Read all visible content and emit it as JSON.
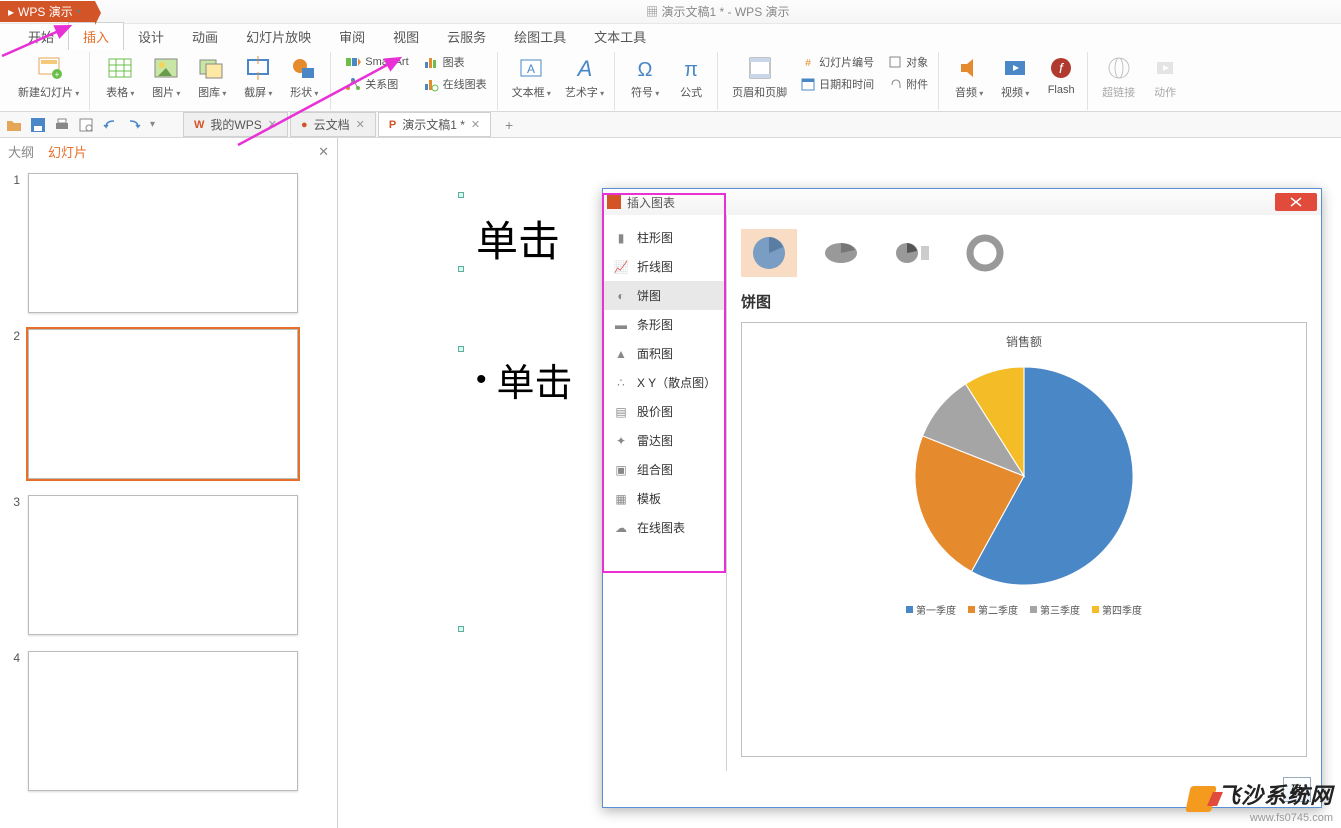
{
  "app_name": "WPS 演示",
  "window_title": "演示文稿1 * - WPS 演示",
  "menu_tabs": [
    "开始",
    "插入",
    "设计",
    "动画",
    "幻灯片放映",
    "审阅",
    "视图",
    "云服务",
    "绘图工具",
    "文本工具"
  ],
  "active_menu_tab": 1,
  "ribbon": {
    "new_slide": "新建幻灯片",
    "table": "表格",
    "picture": "图片",
    "gallery": "图库",
    "screenshot": "截屏",
    "shapes": "形状",
    "smartart": "SmartArt",
    "chart": "图表",
    "relation": "关系图",
    "online_chart": "在线图表",
    "textbox": "文本框",
    "wordart": "艺术字",
    "symbol": "符号",
    "equation": "公式",
    "header_footer": "页眉和页脚",
    "slide_number": "幻灯片编号",
    "datetime": "日期和时间",
    "object": "对象",
    "attachment": "附件",
    "audio": "音频",
    "video": "视频",
    "flash": "Flash",
    "hyperlink": "超链接",
    "action": "动作"
  },
  "doc_tabs": [
    {
      "label": "我的WPS",
      "prefix": "W"
    },
    {
      "label": "云文档",
      "prefix": "●"
    },
    {
      "label": "演示文稿1 *",
      "prefix": "P"
    }
  ],
  "side_tabs": {
    "outline": "大纲",
    "slides": "幻灯片"
  },
  "slide_count": 4,
  "selected_slide": 2,
  "placeholders": {
    "title": "单击",
    "body": "单击"
  },
  "dialog": {
    "title": "插入图表",
    "categories": [
      "柱形图",
      "折线图",
      "饼图",
      "条形图",
      "面积图",
      "X Y（散点图）",
      "股价图",
      "雷达图",
      "组合图",
      "模板",
      "在线图表"
    ],
    "selected_category": 2,
    "subtype_label": "饼图",
    "preview_title": "销售额",
    "legend": [
      "第一季度",
      "第二季度",
      "第三季度",
      "第四季度"
    ],
    "ok_button": "确"
  },
  "chart_data": {
    "type": "pie",
    "title": "销售额",
    "series": [
      {
        "name": "第一季度",
        "value": 58,
        "color": "#4a87c7"
      },
      {
        "name": "第二季度",
        "value": 23,
        "color": "#e68a2e"
      },
      {
        "name": "第三季度",
        "value": 10,
        "color": "#a5a5a5"
      },
      {
        "name": "第四季度",
        "value": 9,
        "color": "#f4bd27"
      }
    ]
  },
  "watermark": {
    "brand": "飞沙系统网",
    "url": "www.fs0745.com"
  }
}
